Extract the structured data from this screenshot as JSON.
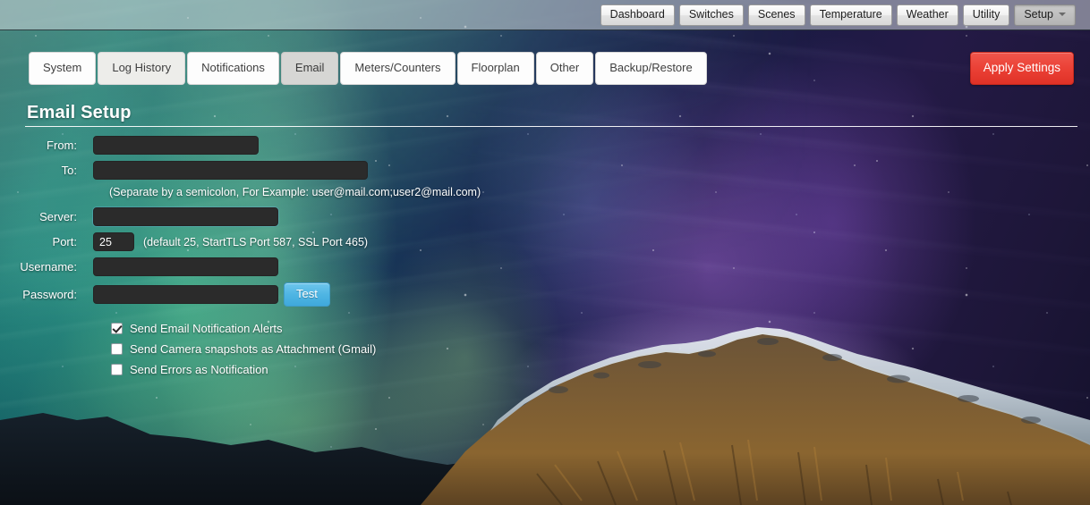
{
  "header": {
    "nav_items": [
      {
        "label": "Dashboard",
        "active": false,
        "caret": false
      },
      {
        "label": "Switches",
        "active": false,
        "caret": false
      },
      {
        "label": "Scenes",
        "active": false,
        "caret": false
      },
      {
        "label": "Temperature",
        "active": false,
        "caret": false
      },
      {
        "label": "Weather",
        "active": false,
        "caret": false
      },
      {
        "label": "Utility",
        "active": false,
        "caret": false
      },
      {
        "label": "Setup",
        "active": true,
        "caret": true
      }
    ]
  },
  "tabs": [
    {
      "label": "System",
      "state": "normal"
    },
    {
      "label": "Log History",
      "state": "hover"
    },
    {
      "label": "Notifications",
      "state": "normal"
    },
    {
      "label": "Email",
      "state": "active"
    },
    {
      "label": "Meters/Counters",
      "state": "normal"
    },
    {
      "label": "Floorplan",
      "state": "normal"
    },
    {
      "label": "Other",
      "state": "normal"
    },
    {
      "label": "Backup/Restore",
      "state": "normal"
    }
  ],
  "toolbar": {
    "apply_label": "Apply Settings"
  },
  "page": {
    "title": "Email Setup"
  },
  "form": {
    "from": {
      "label": "From:",
      "value": "",
      "placeholder": ""
    },
    "to": {
      "label": "To:",
      "value": "",
      "placeholder": ""
    },
    "to_hint": "(Separate by a semicolon, For Example: user@mail.com;user2@mail.com)",
    "server": {
      "label": "Server:",
      "value": "",
      "placeholder": ""
    },
    "port": {
      "label": "Port:",
      "value": "25",
      "placeholder": ""
    },
    "port_hint": "(default 25, StartTLS Port 587, SSL Port 465)",
    "username": {
      "label": "Username:",
      "value": "",
      "placeholder": ""
    },
    "password": {
      "label": "Password:",
      "value": "",
      "placeholder": ""
    },
    "test_label": "Test"
  },
  "checkboxes": [
    {
      "label": "Send Email Notification Alerts",
      "checked": true
    },
    {
      "label": "Send Camera snapshots as Attachment (Gmail)",
      "checked": false
    },
    {
      "label": "Send Errors as Notification",
      "checked": false
    }
  ],
  "colors": {
    "apply_button": "#ea4035",
    "test_button": "#4fb5e3",
    "input_background": "#2b2b2b",
    "active_tab": "#d6d6d4",
    "text_on_background": "#ffffff"
  }
}
